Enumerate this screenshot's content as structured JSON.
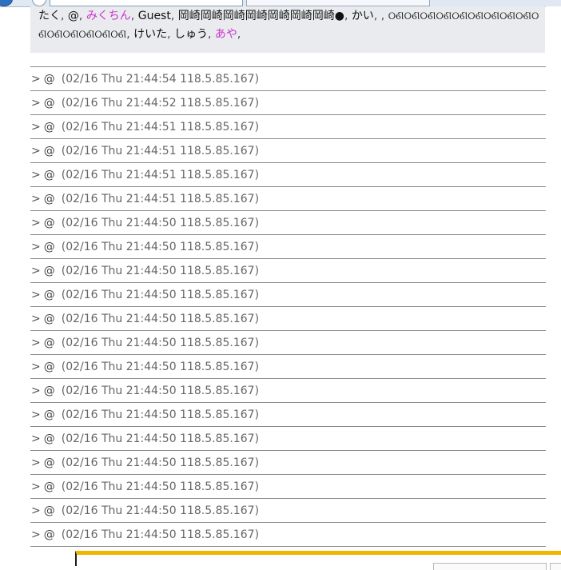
{
  "online_users": [
    {
      "name": "たく",
      "color": "normal"
    },
    {
      "name": "@",
      "color": "normal"
    },
    {
      "name": "みくちん",
      "color": "pink"
    },
    {
      "name": "Guest",
      "color": "normal"
    },
    {
      "name": "岡崎岡崎岡崎岡崎岡崎岡崎岡崎●",
      "color": "normal"
    },
    {
      "name": "かい",
      "color": "normal"
    },
    {
      "name": "",
      "color": "normal"
    },
    {
      "name": "ଠଣଠଣଠଣଠଣଠଣଠଣଠଣଠଣଠଣଠଣଠଣଠଣଠଣଠଣଠଣ",
      "color": "normal"
    },
    {
      "name": "けいた",
      "color": "normal"
    },
    {
      "name": "しゅう",
      "color": "normal"
    },
    {
      "name": "あや",
      "color": "pink"
    }
  ],
  "separator": ",",
  "colors": {
    "pink": "#cc33cc",
    "normal": "#111111",
    "accent_bar": "#f2b400"
  },
  "log_entries": [
    {
      "mark": ">",
      "name": "@",
      "meta": "(02/16 Thu 21:44:54 118.5.85.167)"
    },
    {
      "mark": ">",
      "name": "@",
      "meta": "(02/16 Thu 21:44:52 118.5.85.167)"
    },
    {
      "mark": ">",
      "name": "@",
      "meta": "(02/16 Thu 21:44:51 118.5.85.167)"
    },
    {
      "mark": ">",
      "name": "@",
      "meta": "(02/16 Thu 21:44:51 118.5.85.167)"
    },
    {
      "mark": ">",
      "name": "@",
      "meta": "(02/16 Thu 21:44:51 118.5.85.167)"
    },
    {
      "mark": ">",
      "name": "@",
      "meta": "(02/16 Thu 21:44:51 118.5.85.167)"
    },
    {
      "mark": ">",
      "name": "@",
      "meta": "(02/16 Thu 21:44:50 118.5.85.167)"
    },
    {
      "mark": ">",
      "name": "@",
      "meta": "(02/16 Thu 21:44:50 118.5.85.167)"
    },
    {
      "mark": ">",
      "name": "@",
      "meta": "(02/16 Thu 21:44:50 118.5.85.167)"
    },
    {
      "mark": ">",
      "name": "@",
      "meta": "(02/16 Thu 21:44:50 118.5.85.167)"
    },
    {
      "mark": ">",
      "name": "@",
      "meta": "(02/16 Thu 21:44:50 118.5.85.167)"
    },
    {
      "mark": ">",
      "name": "@",
      "meta": "(02/16 Thu 21:44:50 118.5.85.167)"
    },
    {
      "mark": ">",
      "name": "@",
      "meta": "(02/16 Thu 21:44:50 118.5.85.167)"
    },
    {
      "mark": ">",
      "name": "@",
      "meta": "(02/16 Thu 21:44:50 118.5.85.167)"
    },
    {
      "mark": ">",
      "name": "@",
      "meta": "(02/16 Thu 21:44:50 118.5.85.167)"
    },
    {
      "mark": ">",
      "name": "@",
      "meta": "(02/16 Thu 21:44:50 118.5.85.167)"
    },
    {
      "mark": ">",
      "name": "@",
      "meta": "(02/16 Thu 21:44:50 118.5.85.167)"
    },
    {
      "mark": ">",
      "name": "@",
      "meta": "(02/16 Thu 21:44:50 118.5.85.167)"
    },
    {
      "mark": ">",
      "name": "@",
      "meta": "(02/16 Thu 21:44:50 118.5.85.167)"
    },
    {
      "mark": ">",
      "name": "@",
      "meta": "(02/16 Thu 21:44:50 118.5.85.167)"
    }
  ]
}
